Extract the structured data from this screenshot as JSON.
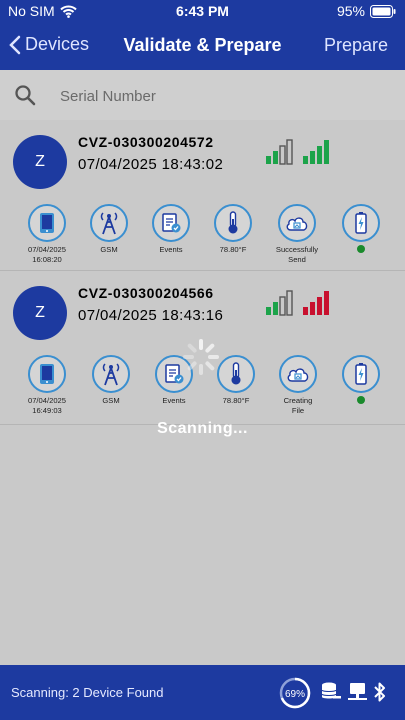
{
  "status_bar": {
    "carrier": "No SIM",
    "time": "6:43 PM",
    "battery": "95%"
  },
  "nav": {
    "back_label": "Devices",
    "title": "Validate & Prepare",
    "action_label": "Prepare"
  },
  "search": {
    "placeholder": "Serial Number"
  },
  "devices": [
    {
      "avatar": "Z",
      "name": "CVZ-030300204572",
      "datetime": "07/04/2025  18:43:02",
      "second_signal_color": "#1ca34a",
      "actions": [
        {
          "label_line1": "07/04/2025",
          "label_line2": "16:08:20"
        },
        {
          "label_line1": "GSM",
          "label_line2": ""
        },
        {
          "label_line1": "Events",
          "label_line2": ""
        },
        {
          "label_line1": "78.80°F",
          "label_line2": ""
        },
        {
          "label_line1": "Successfully",
          "label_line2": "Send"
        },
        {
          "status_color": "#1a8a2c"
        }
      ]
    },
    {
      "avatar": "Z",
      "name": "CVZ-030300204566",
      "datetime": "07/04/2025  18:43:16",
      "second_signal_color": "#c8102e",
      "actions": [
        {
          "label_line1": "07/04/2025",
          "label_line2": "16:49:03"
        },
        {
          "label_line1": "GSM",
          "label_line2": ""
        },
        {
          "label_line1": "Events",
          "label_line2": ""
        },
        {
          "label_line1": "78.80°F",
          "label_line2": ""
        },
        {
          "label_line1": "Creating",
          "label_line2": "File"
        },
        {
          "status_color": "#1a8a2c"
        }
      ]
    }
  ],
  "overlay": {
    "scanning_label": "Scanning..."
  },
  "footer": {
    "status": "Scanning: 2 Device Found",
    "progress_label": "69%",
    "progress_value": 69
  },
  "colors": {
    "brand": "#1d3aa0",
    "accent_ring": "#3a8fd0",
    "good": "#1ca34a",
    "bad": "#c8102e"
  }
}
